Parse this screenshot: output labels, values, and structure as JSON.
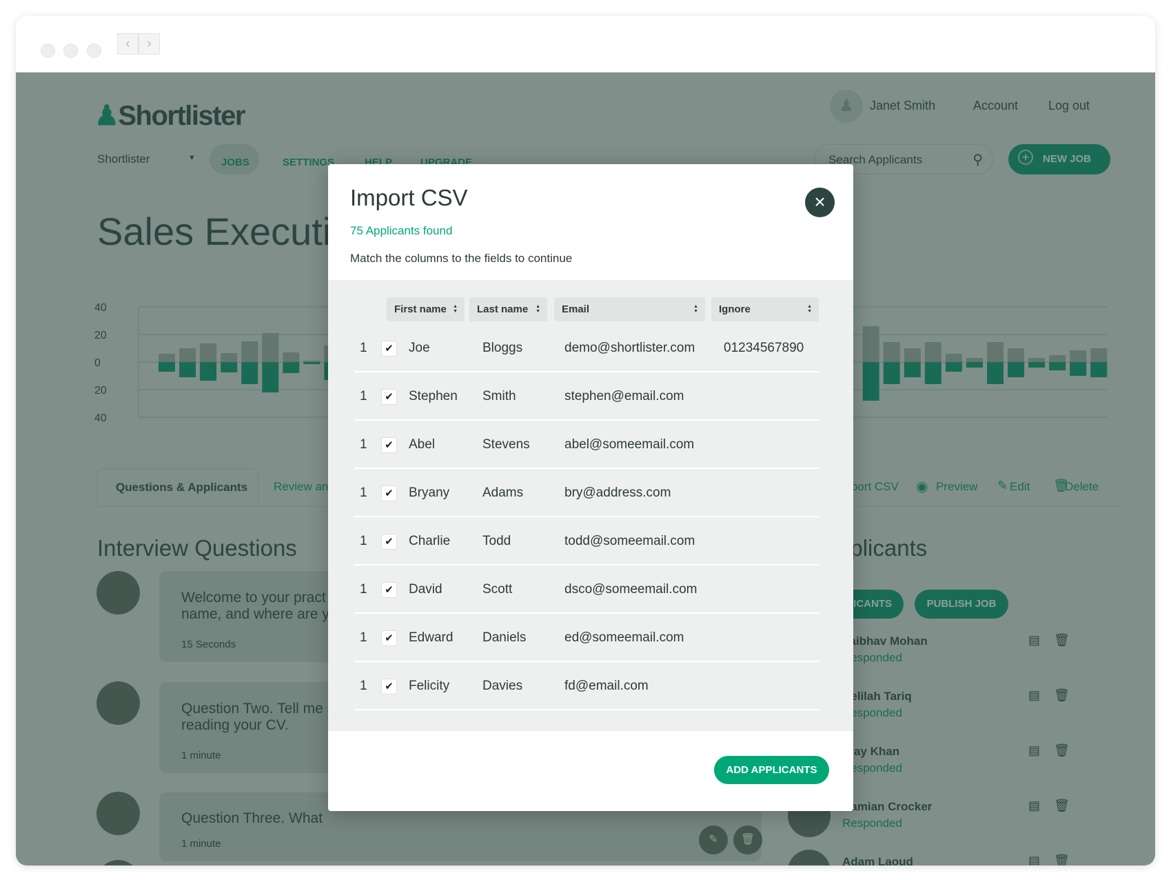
{
  "browser": {
    "back_icon": "‹",
    "forward_icon": "›"
  },
  "header": {
    "logo": "Shortlister",
    "org_select": "Shortlister",
    "nav": [
      "JOBS",
      "SETTINGS",
      "HELP",
      "UPGRADE"
    ],
    "user_name": "Janet Smith",
    "account": "Account",
    "logout": "Log out",
    "search_placeholder": "Search Applicants",
    "new_job": "NEW JOB"
  },
  "job": {
    "title": "Sales Executive"
  },
  "chart_data": {
    "type": "bar",
    "stacked_diverging": true,
    "y_ticks": [
      "40",
      "20",
      "0",
      "20",
      "40"
    ],
    "ylim": [
      -40,
      40
    ],
    "grid": true,
    "series": [
      {
        "name": "",
        "color": "#637670",
        "values": [
          6,
          10,
          13.5,
          6.5,
          15,
          21,
          7,
          1,
          12,
          null,
          null,
          null,
          null,
          null,
          null,
          null,
          null,
          null,
          null,
          null,
          null,
          null,
          null,
          null,
          null,
          null,
          null,
          null,
          null,
          null,
          null,
          null,
          null,
          null,
          26,
          14.5,
          10,
          14.5,
          6,
          3,
          14.5,
          10,
          3,
          5,
          8.5,
          10
        ]
      },
      {
        "name": "",
        "color": "#1a6b55",
        "values": [
          -7,
          -11,
          -13.5,
          -7.5,
          -16,
          -22,
          -8,
          -1.5,
          -13,
          null,
          null,
          null,
          null,
          null,
          null,
          null,
          null,
          null,
          null,
          null,
          null,
          null,
          null,
          null,
          null,
          null,
          null,
          null,
          null,
          null,
          null,
          null,
          null,
          null,
          -28,
          -16,
          -11,
          -16,
          -7,
          -4,
          -16,
          -11,
          -4,
          -6,
          -10,
          -11
        ]
      }
    ]
  },
  "tabs": {
    "active": "Questions & Applicants",
    "second": "Review and",
    "actions": {
      "import": "Import CSV",
      "preview": "Preview",
      "edit": "Edit",
      "delete": "Delete"
    }
  },
  "questions": {
    "heading": "Interview Questions",
    "items": [
      {
        "line1": "Welcome to your pract",
        "line2": "name, and where are y",
        "duration": "15 Seconds"
      },
      {
        "line1": "Question Two. Tell me s",
        "line2": "reading your CV.",
        "duration": "1 minute"
      },
      {
        "line1": "Question Three. What",
        "line2": "",
        "duration": "1 minute"
      }
    ]
  },
  "applicants": {
    "heading": "Applicants",
    "button1": "ICANTS",
    "publish": "PUBLISH JOB",
    "items": [
      {
        "name": "Vaibhav Mohan",
        "status": "Responded"
      },
      {
        "name": "Delilah Tariq",
        "status": "Responded"
      },
      {
        "name": "Ajay Khan",
        "status": "Responded"
      },
      {
        "name": "Damian Crocker",
        "status": "Responded"
      },
      {
        "name": "Adam Laoud",
        "status": ""
      }
    ]
  },
  "modal": {
    "title": "Import CSV",
    "found": "75 Applicants found",
    "instructions": "Match the columns to the fields to continue",
    "close_icon": "×",
    "columns": [
      "First name",
      "Last name",
      "Email",
      "Ignore"
    ],
    "rows": [
      {
        "n": "1",
        "checked": true,
        "first": "Joe",
        "last": "Bloggs",
        "email": "demo@shortlister.com",
        "extra": "01234567890"
      },
      {
        "n": "1",
        "checked": true,
        "first": "Stephen",
        "last": "Smith",
        "email": "stephen@email.com",
        "extra": ""
      },
      {
        "n": "1",
        "checked": true,
        "first": "Abel",
        "last": "Stevens",
        "email": "abel@someemail.com",
        "extra": ""
      },
      {
        "n": "1",
        "checked": true,
        "first": "Bryany",
        "last": "Adams",
        "email": "bry@address.com",
        "extra": ""
      },
      {
        "n": "1",
        "checked": true,
        "first": "Charlie",
        "last": "Todd",
        "email": "todd@someemail.com",
        "extra": ""
      },
      {
        "n": "1",
        "checked": true,
        "first": "David",
        "last": "Scott",
        "email": "dsco@someemail.com",
        "extra": ""
      },
      {
        "n": "1",
        "checked": true,
        "first": "Edward",
        "last": "Daniels",
        "email": "ed@someemail.com",
        "extra": ""
      },
      {
        "n": "1",
        "checked": true,
        "first": "Felicity",
        "last": "Davies",
        "email": "fd@email.com",
        "extra": ""
      }
    ],
    "submit": "ADD APPLICANTS"
  },
  "colors": {
    "accent": "#00a878",
    "brand_dark": "#1a6b55",
    "overlay_bg": "#808f8a"
  }
}
